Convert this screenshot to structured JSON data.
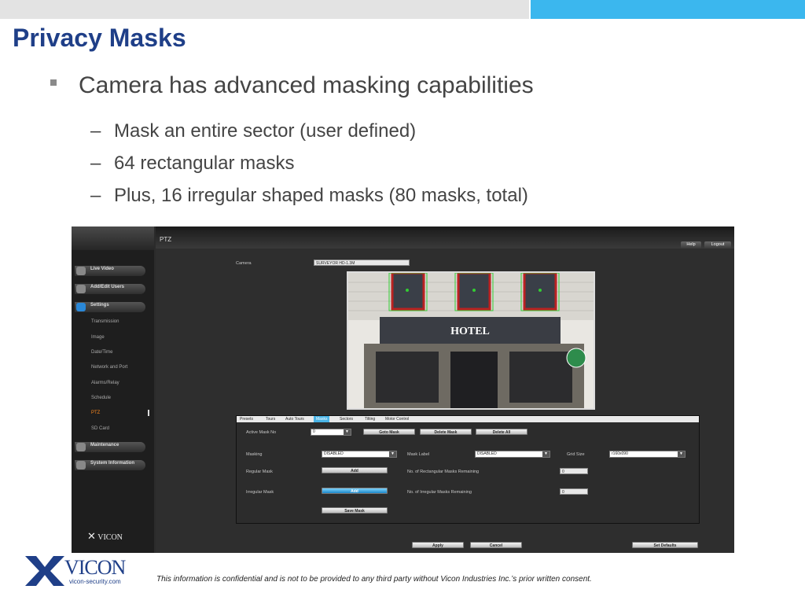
{
  "slide": {
    "title": "Privacy Masks",
    "bullet": "Camera has advanced masking capabilities",
    "subbullets": [
      "Mask an entire sector (user defined)",
      "64 rectangular masks",
      "Plus, 16 irregular shaped masks  (80 masks, total)"
    ],
    "footer": "This information is confidential and is not to be provided to any third party without Vicon Industries Inc.’s  prior written consent.",
    "logo_text": "VICON",
    "logo_url": "vicon-security.com",
    "colors": {
      "title": "#1f3f88",
      "accent_bar": "#3bb7ee"
    }
  },
  "app": {
    "page_title": "PTZ",
    "top_buttons": {
      "help": "Help",
      "logout": "Logout"
    },
    "nav": {
      "groups": [
        {
          "label": "Live Video",
          "icon": "video-icon"
        },
        {
          "label": "Add/Edit Users",
          "icon": "users-icon"
        },
        {
          "label": "Settings",
          "icon": "settings-icon"
        },
        {
          "label": "Maintenance",
          "icon": "wrench-icon"
        },
        {
          "label": "System Information",
          "icon": "info-icon"
        }
      ],
      "settings_items": [
        "Transmission",
        "Image",
        "Date/Time",
        "Network and Port",
        "Alarms/Relay",
        "Schedule",
        "PTZ",
        "SD Card"
      ],
      "active_item": "PTZ",
      "brand": "VICON"
    },
    "camera": {
      "label": "Camera",
      "value": "SURVEYOR HD-1.3M",
      "image_sign": "HOTEL"
    },
    "tabs": [
      "Presets",
      "Tours",
      "Auto Tours",
      "Masks",
      "Sectors",
      "Tilting",
      "Motor Control"
    ],
    "active_tab": "Masks",
    "form": {
      "active_mask_label": "Active Mask No",
      "active_mask_value": "0",
      "goto_mask": "Goto Mask",
      "delete_mask": "Delete Mask",
      "delete_all": "Delete All",
      "masking_label": "Masking",
      "masking_value": "DISABLED",
      "mask_label_label": "Mask Label",
      "mask_label_value": "DISABLED",
      "grid_size_label": "Grid Size",
      "grid_size_value": "r160x090",
      "regular_mask_label": "Regular Mask",
      "irregular_mask_label": "Irregular Mask",
      "add": "Add",
      "rect_remaining_label": "No. of Rectangular Masks Remaining",
      "rect_remaining_value": "0",
      "irreg_remaining_label": "No. of Irregular Masks Remaining",
      "irreg_remaining_value": "0",
      "save_mask": "Save Mask"
    },
    "bottom_buttons": {
      "apply": "Apply",
      "cancel": "Cancel",
      "set_defaults": "Set Defaults"
    }
  }
}
